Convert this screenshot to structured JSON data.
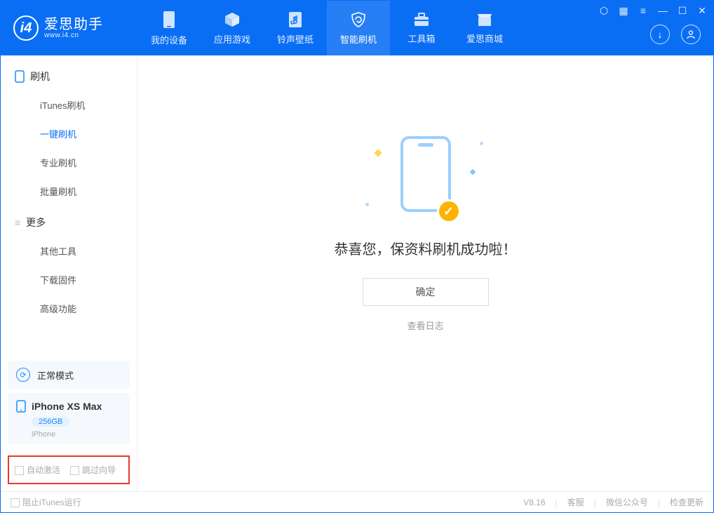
{
  "brand": {
    "name": "爱思助手",
    "url": "www.i4.cn"
  },
  "nav": [
    {
      "label": "我的设备"
    },
    {
      "label": "应用游戏"
    },
    {
      "label": "铃声壁纸"
    },
    {
      "label": "智能刷机"
    },
    {
      "label": "工具箱"
    },
    {
      "label": "爱思商城"
    }
  ],
  "sidebar": {
    "group1": {
      "title": "刷机",
      "items": [
        "iTunes刷机",
        "一键刷机",
        "专业刷机",
        "批量刷机"
      ]
    },
    "group2": {
      "title": "更多",
      "items": [
        "其他工具",
        "下载固件",
        "高级功能"
      ]
    }
  },
  "mode_card": {
    "label": "正常模式"
  },
  "device": {
    "name": "iPhone XS Max",
    "capacity": "256GB",
    "type": "iPhone"
  },
  "options": {
    "auto_activate": "自动激活",
    "skip_guide": "跳过向导"
  },
  "main": {
    "success_message": "恭喜您，保资料刷机成功啦！",
    "ok_button": "确定",
    "view_log": "查看日志"
  },
  "footer": {
    "block_itunes": "阻止iTunes运行",
    "version": "V8.16",
    "support": "客服",
    "wechat": "微信公众号",
    "check_update": "检查更新"
  }
}
